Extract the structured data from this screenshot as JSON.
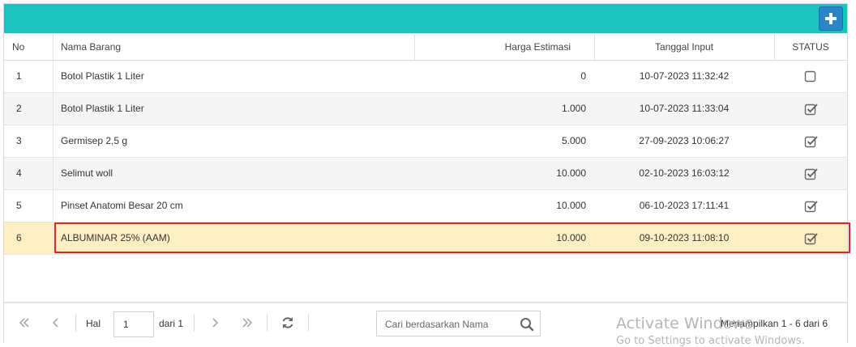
{
  "header": {
    "col_no": "No",
    "col_name": "Nama Barang",
    "col_price": "Harga Estimasi",
    "col_date": "Tanggal Input",
    "col_status": "STATUS"
  },
  "rows": [
    {
      "no": "1",
      "name": "Botol Plastik 1 Liter",
      "price": "0",
      "date": "10-07-2023 11:32:42",
      "status": false
    },
    {
      "no": "2",
      "name": "Botol Plastik 1 Liter",
      "price": "1.000",
      "date": "10-07-2023 11:33:04",
      "status": true
    },
    {
      "no": "3",
      "name": "Germisep 2,5 g",
      "price": "5.000",
      "date": "27-09-2023 10:06:27",
      "status": true
    },
    {
      "no": "4",
      "name": "Selimut woll",
      "price": "10.000",
      "date": "02-10-2023 16:03:12",
      "status": true
    },
    {
      "no": "5",
      "name": "Pinset Anatomi Besar 20 cm",
      "price": "10.000",
      "date": "06-10-2023 17:11:41",
      "status": true
    },
    {
      "no": "6",
      "name": "ALBUMINAR 25% (AAM)",
      "price": "10.000",
      "date": "09-10-2023 11:08:10",
      "status": true
    }
  ],
  "pager": {
    "page_label": "Hal",
    "page_value": "1",
    "of_label": "dari 1",
    "search_placeholder": "Cari berdasarkan Nama",
    "summary": "Menampilkan 1 - 6 dari 6"
  },
  "watermark": {
    "line1": "Activate Windows",
    "line2": "Go to Settings to activate Windows."
  },
  "colors": {
    "topbar": "#1cc3bd",
    "add_button": "#2a86c7",
    "selected_row": "#fdefc3",
    "highlight_border": "#e8231c"
  },
  "icons": [
    "plus-icon",
    "checkbox-icon",
    "first-page-icon",
    "prev-page-icon",
    "next-page-icon",
    "last-page-icon",
    "refresh-icon",
    "search-icon"
  ]
}
